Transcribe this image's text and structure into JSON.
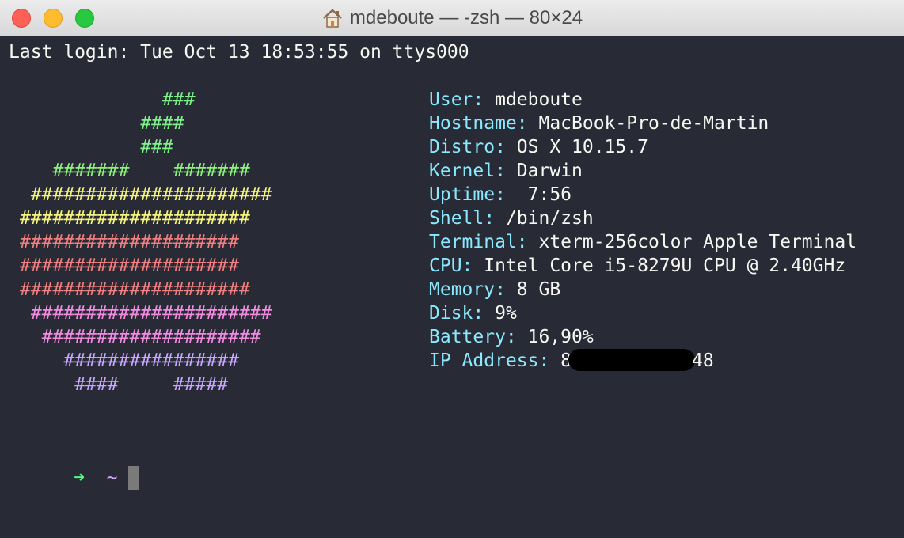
{
  "window": {
    "title": "mdeboute — -zsh — 80×24",
    "home_icon": "home-icon"
  },
  "terminal": {
    "last_login": "Last login: Tue Oct 13 18:53:55 on ttys000",
    "art": [
      {
        "text": "             ###",
        "color": "#7ef08a"
      },
      {
        "text": "           ####",
        "color": "#7ef08a"
      },
      {
        "text": "           ###",
        "color": "#7ef08a"
      },
      {
        "text": "   #######    #######",
        "color": "#8cf27a"
      },
      {
        "text": " ######################",
        "color": "#f4f47a"
      },
      {
        "text": "#####################",
        "color": "#f4f47a"
      },
      {
        "text": "####################",
        "color": "#f07f7f"
      },
      {
        "text": "####################",
        "color": "#f07f7f"
      },
      {
        "text": "#####################",
        "color": "#f07f7f"
      },
      {
        "text": " ######################",
        "color": "#f08ce0"
      },
      {
        "text": "  ####################",
        "color": "#f08ce0"
      },
      {
        "text": "    ################",
        "color": "#c9a6ff"
      },
      {
        "text": "     ####     #####",
        "color": "#c9a6ff"
      }
    ],
    "info": [
      {
        "key": "User:",
        "value": " mdeboute"
      },
      {
        "key": "Hostname:",
        "value": " MacBook-Pro-de-Martin"
      },
      {
        "key": "Distro:",
        "value": " OS X 10.15.7"
      },
      {
        "key": "Kernel:",
        "value": " Darwin"
      },
      {
        "key": "Uptime:",
        "value": "  7:56"
      },
      {
        "key": "Shell:",
        "value": " /bin/zsh"
      },
      {
        "key": "Terminal:",
        "value": " xterm-256color Apple Terminal"
      },
      {
        "key": "CPU:",
        "value": " Intel Core i5-8279U CPU @ 2.40GHz"
      },
      {
        "key": "Memory:",
        "value": " 8 GB"
      },
      {
        "key": "Disk:",
        "value": " 9%"
      },
      {
        "key": "Battery:",
        "value": " 16,90%"
      }
    ],
    "ip": {
      "key": "IP Address:",
      "value_start": " 8",
      "value_end": "48"
    },
    "prompt": {
      "arrow": "➜",
      "dir": "~"
    }
  }
}
